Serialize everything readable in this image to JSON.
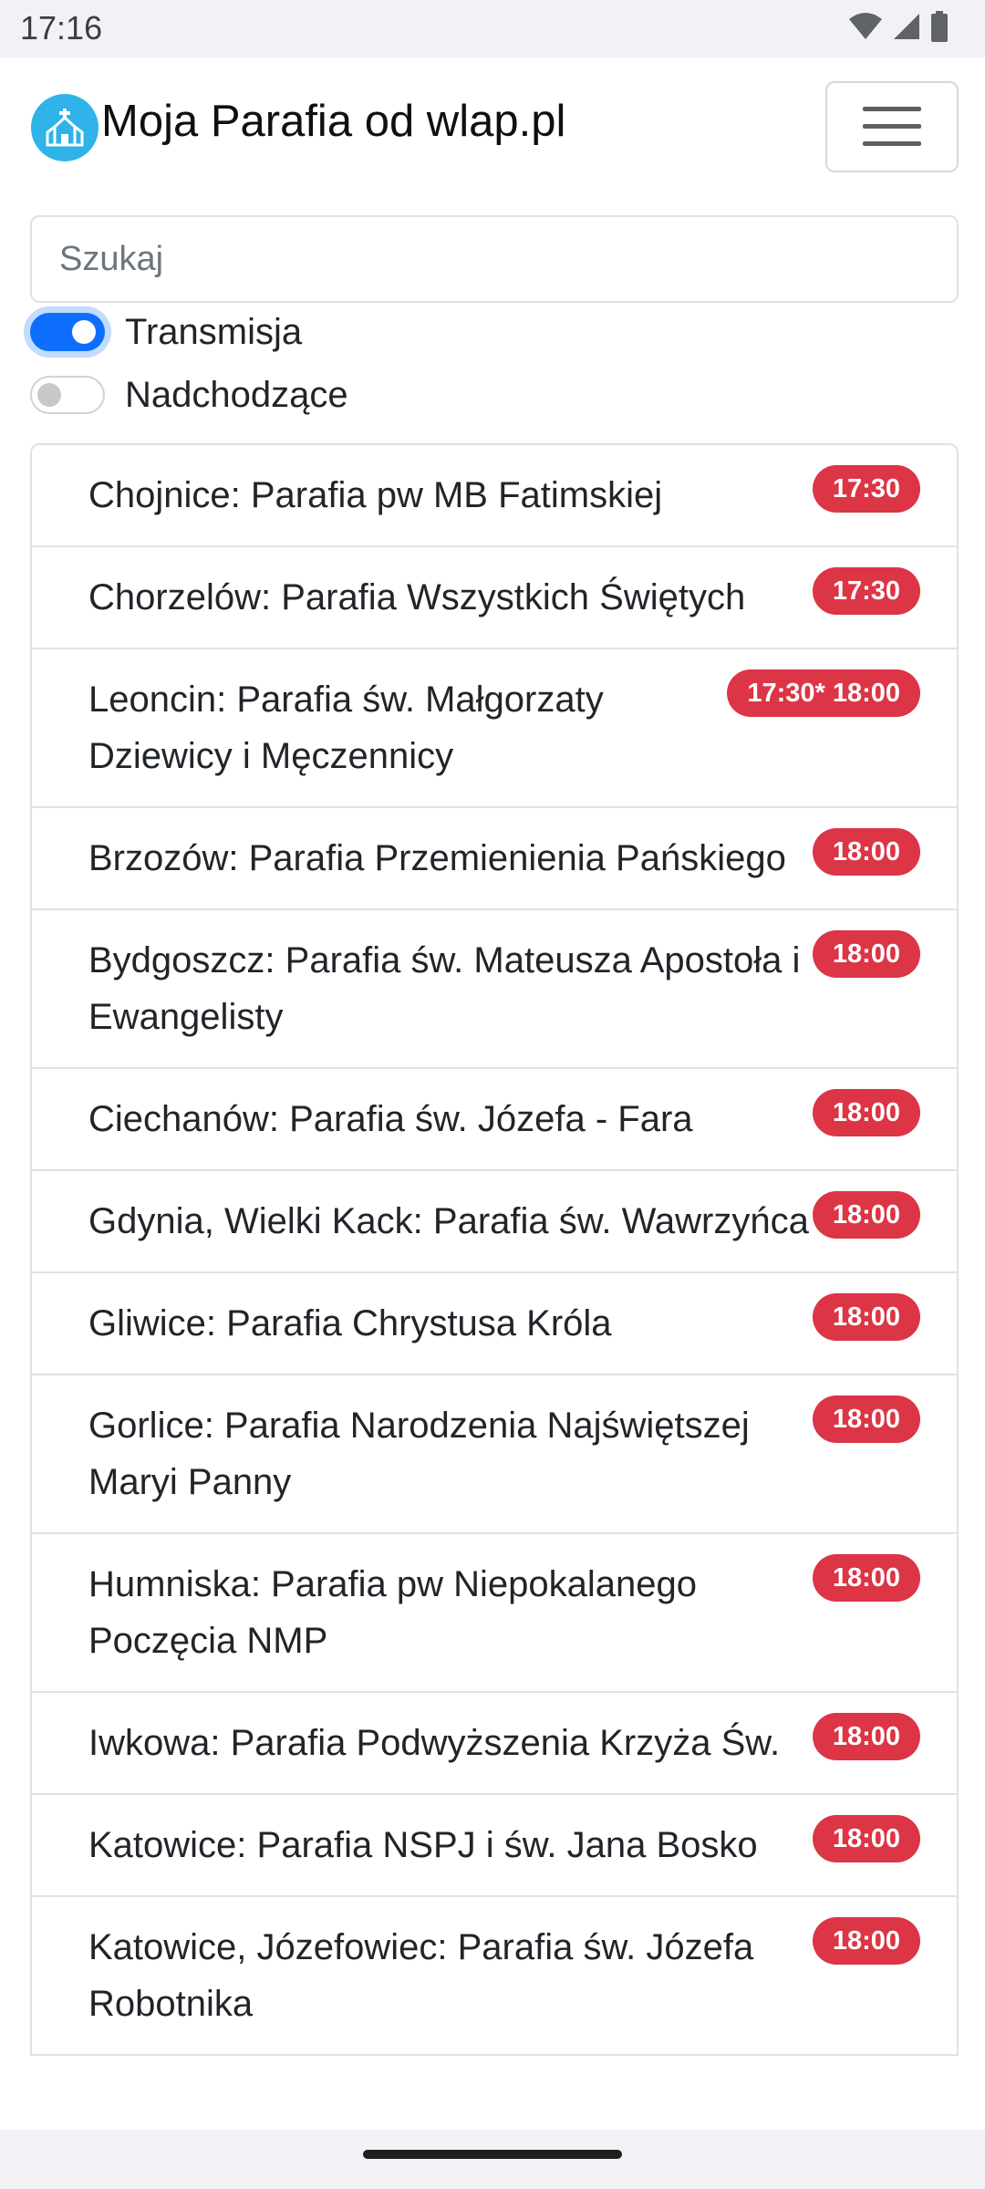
{
  "status_bar": {
    "time": "17:16",
    "icons": [
      "wifi-icon",
      "signal-icon",
      "battery-icon"
    ]
  },
  "navbar": {
    "title": "Moja Parafia od wlap.pl",
    "logo_icon": "church-icon",
    "menu_icon": "hamburger-icon"
  },
  "search": {
    "placeholder": "Szukaj",
    "value": ""
  },
  "filters": {
    "transmisja": {
      "label": "Transmisja",
      "checked": true
    },
    "nadchodzace": {
      "label": "Nadchodzące",
      "checked": false
    }
  },
  "colors": {
    "accent": "#0d6efd",
    "badge": "#dc3545",
    "logo": "#2fb3e8"
  },
  "parishes": [
    {
      "name": "Chojnice: Parafia pw MB Fatimskiej",
      "time": "17:30"
    },
    {
      "name": "Chorzelów: Parafia Wszystkich Świętych",
      "time": "17:30"
    },
    {
      "name": "Leoncin: Parafia św. Małgorzaty Dziewicy i Męczennicy",
      "time": "17:30* 18:00"
    },
    {
      "name": "Brzozów: Parafia Przemienienia Pańskiego",
      "time": "18:00"
    },
    {
      "name": "Bydgoszcz: Parafia św. Mateusza Apostoła i Ewangelisty",
      "time": "18:00"
    },
    {
      "name": "Ciechanów: Parafia św. Józefa - Fara",
      "time": "18:00"
    },
    {
      "name": "Gdynia, Wielki Kack: Parafia św. Wawrzyńca",
      "time": "18:00"
    },
    {
      "name": "Gliwice: Parafia Chrystusa Króla",
      "time": "18:00"
    },
    {
      "name": "Gorlice: Parafia Narodzenia Najświętszej Maryi Panny",
      "time": "18:00"
    },
    {
      "name": "Humniska: Parafia pw Niepokalanego Poczęcia NMP",
      "time": "18:00"
    },
    {
      "name": "Iwkowa: Parafia Podwyższenia Krzyża Św.",
      "time": "18:00"
    },
    {
      "name": "Katowice: Parafia NSPJ i św. Jana Bosko",
      "time": "18:00"
    },
    {
      "name": "Katowice, Józefowiec: Parafia św. Józefa Robotnika",
      "time": "18:00"
    }
  ]
}
